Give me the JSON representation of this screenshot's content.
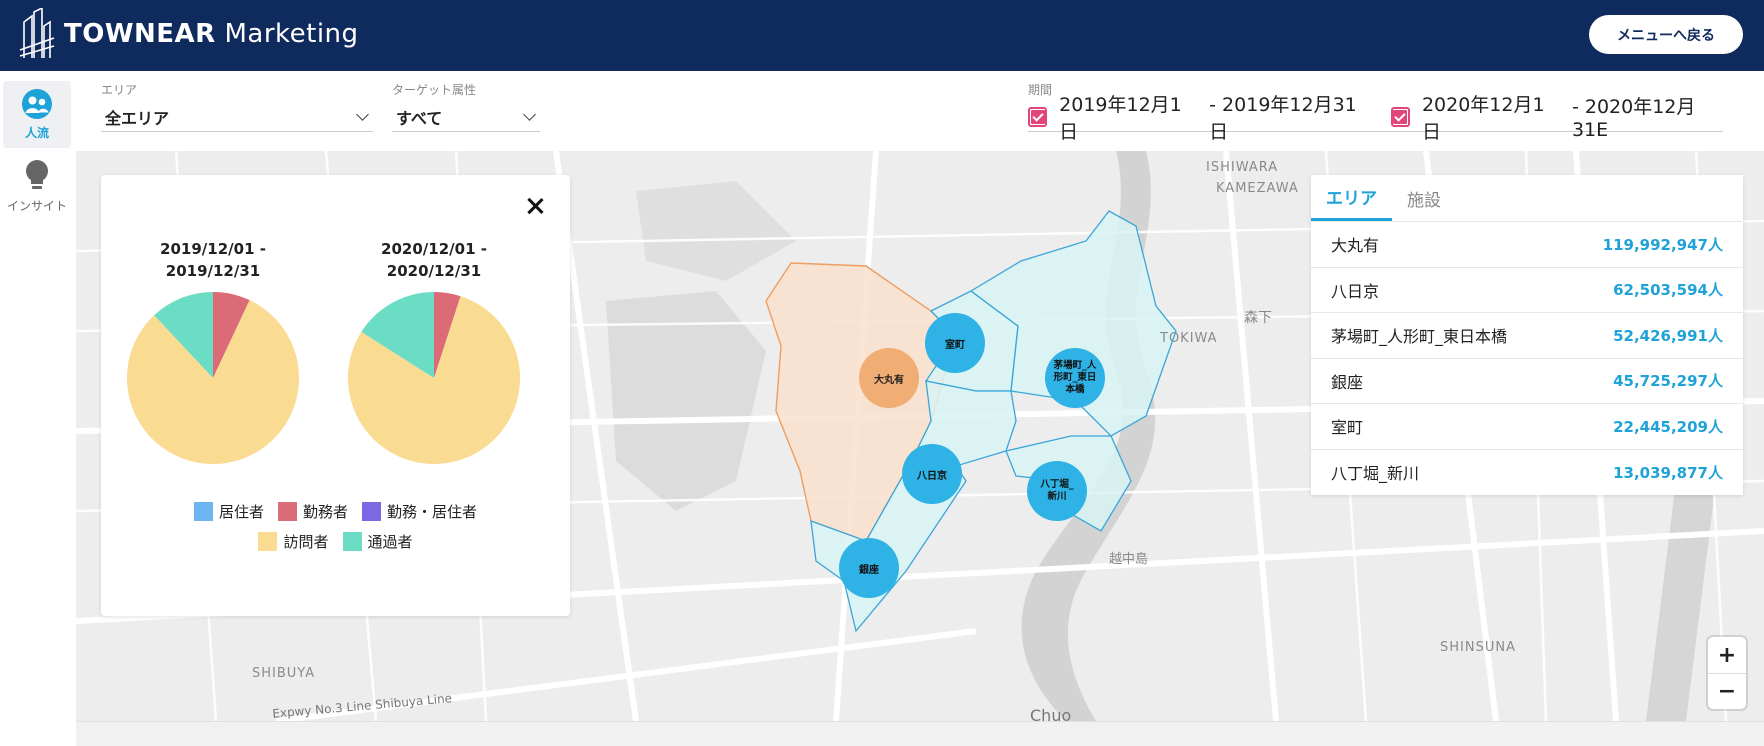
{
  "header": {
    "brand_bold": "TOWNEAR",
    "brand_light": "Marketing",
    "back_button": "メニューへ戻る"
  },
  "sidebar": {
    "items": [
      {
        "label": "人流",
        "icon": "people-icon",
        "active": true
      },
      {
        "label": "インサイト",
        "icon": "lightbulb-icon",
        "active": false
      }
    ]
  },
  "filters": {
    "area": {
      "caption": "エリア",
      "value": "全エリア"
    },
    "target": {
      "caption": "ターゲット属性",
      "value": "すべて"
    },
    "period": {
      "caption": "期間",
      "ranges": [
        {
          "from": "2019年12月1日",
          "to": "- 2019年12月31日",
          "checked": true
        },
        {
          "from": "2020年12月1日",
          "to": "- 2020年12月31E",
          "checked": true
        }
      ]
    }
  },
  "map_labels": {
    "places": [
      "ISHIWARA",
      "KAMEZAWA",
      "TOKIWA",
      "森下",
      "越中島",
      "SHINSUNA",
      "SHIBUYA",
      "Expwy No.3 Line Shibuya Line",
      "Chuo"
    ],
    "areas": [
      "大丸有",
      "室町",
      "茅場町_人形町_東日本橋",
      "八日京",
      "八丁堀_新川",
      "銀座"
    ]
  },
  "chart_data": [
    {
      "type": "pie",
      "title": "2019/12/01 - 2019/12/31",
      "categories": [
        "居住者",
        "勤務者",
        "勤務・居住者",
        "訪問者",
        "通過者"
      ],
      "values": [
        0,
        7,
        0,
        81,
        12
      ],
      "colors": [
        "#6cb4f2",
        "#db6b77",
        "#7d68e3",
        "#fadb92",
        "#6bddc4"
      ]
    },
    {
      "type": "pie",
      "title": "2020/12/01 - 2020/12/31",
      "categories": [
        "居住者",
        "勤務者",
        "勤務・居住者",
        "訪問者",
        "通過者"
      ],
      "values": [
        0,
        5,
        0,
        79,
        16
      ],
      "colors": [
        "#6cb4f2",
        "#db6b77",
        "#7d68e3",
        "#fadb92",
        "#6bddc4"
      ]
    }
  ],
  "pie_titles": [
    {
      "line1": "2019/12/01 -",
      "line2": "2019/12/31"
    },
    {
      "line1": "2020/12/01 -",
      "line2": "2020/12/31"
    }
  ],
  "legend": [
    {
      "label": "居住者",
      "color": "#6cb4f2"
    },
    {
      "label": "勤務者",
      "color": "#db6b77"
    },
    {
      "label": "勤務・居住者",
      "color": "#7d68e3"
    },
    {
      "label": "訪問者",
      "color": "#fadb92"
    },
    {
      "label": "通過者",
      "color": "#6bddc4"
    }
  ],
  "ranking": {
    "tabs": [
      "エリア",
      "施設"
    ],
    "rows": [
      {
        "name": "大丸有",
        "value": "119,992,947人"
      },
      {
        "name": "八日京",
        "value": "62,503,594人"
      },
      {
        "name": "茅場町_人形町_東日本橋",
        "value": "52,426,991人"
      },
      {
        "name": "銀座",
        "value": "45,725,297人"
      },
      {
        "name": "室町",
        "value": "22,445,209人"
      },
      {
        "name": "八丁堀_新川",
        "value": "13,039,877人"
      }
    ]
  },
  "zoom": {
    "in": "+",
    "out": "−"
  }
}
